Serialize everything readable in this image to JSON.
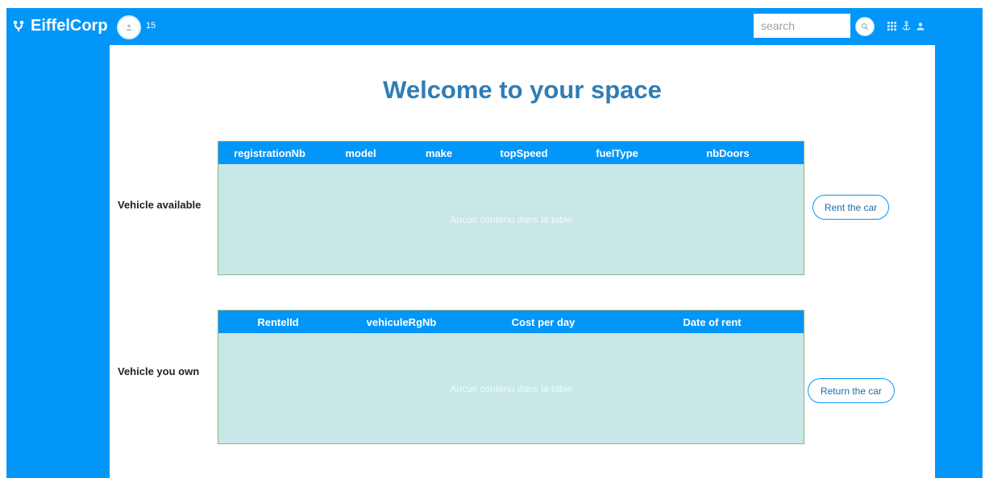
{
  "brand": {
    "name": "EiffelCorp",
    "icon": "logo-icon"
  },
  "header": {
    "notification_count": "15",
    "search_placeholder": "search",
    "icons": [
      "grid-icon",
      "anchor-icon",
      "user-icon"
    ]
  },
  "main": {
    "title": "Welcome to your space",
    "available": {
      "label": "Vehicle available",
      "columns": [
        "registrationNb",
        "model",
        "make",
        "topSpeed",
        "fuelType",
        "nbDoors"
      ],
      "empty_text": "Aucun contenu dans la table",
      "action": "Rent the car"
    },
    "owned": {
      "label": "Vehicle you own",
      "columns": [
        "RentelId",
        "vehiculeRgNb",
        "Cost per day",
        "Date of rent"
      ],
      "empty_text": "Aucun contenu dans la table",
      "action": "Return the car"
    }
  },
  "colors": {
    "accent": "#0396f9",
    "title": "#2e7db5",
    "table_body": "#c8e7e7"
  }
}
